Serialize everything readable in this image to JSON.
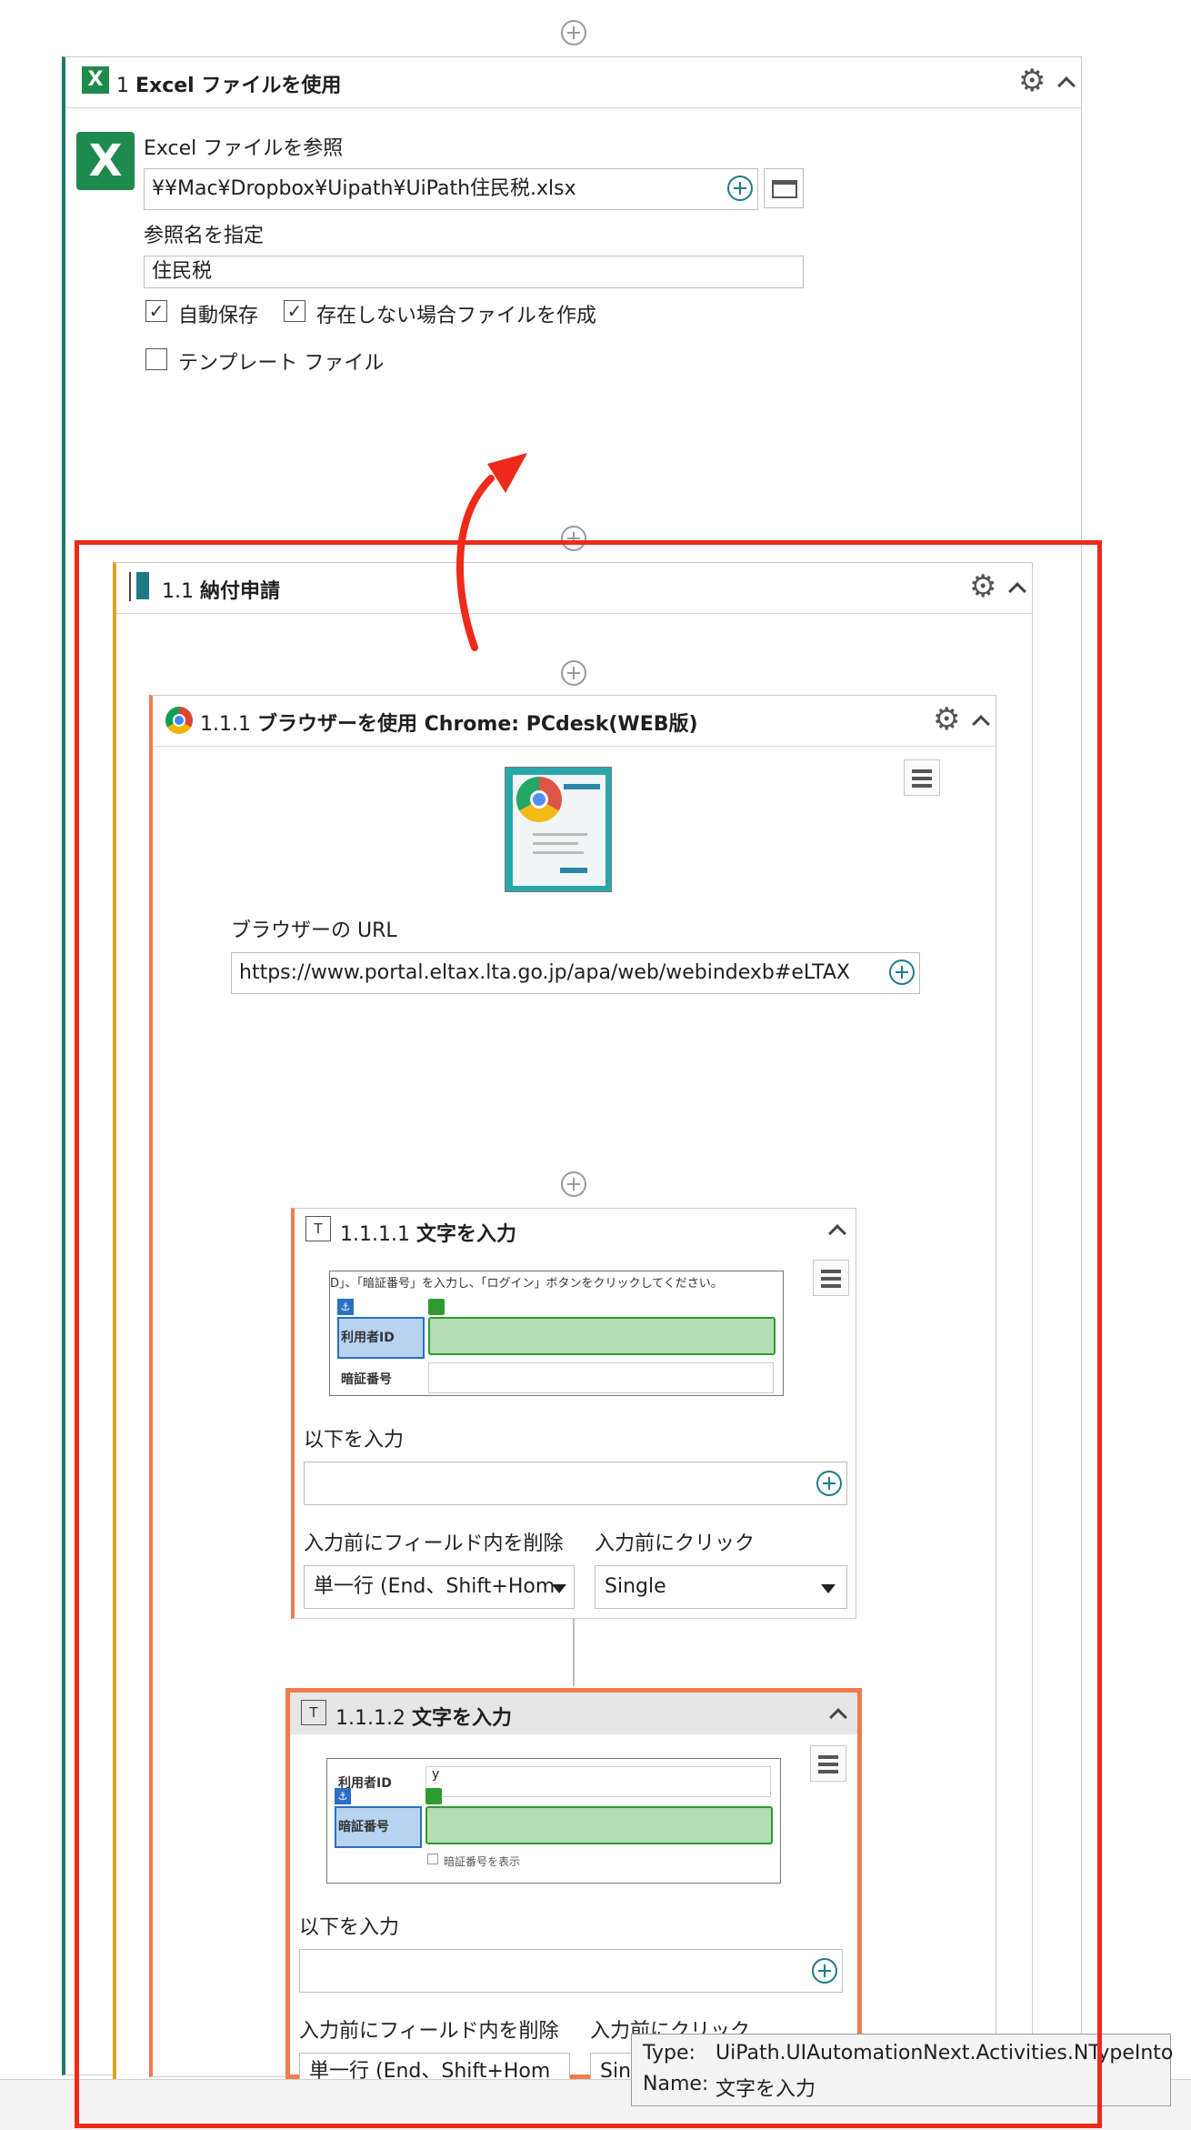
{
  "top_scope": {
    "title_num": "1",
    "title": "Excel ファイルを使用",
    "file_label": "Excel ファイルを参照",
    "file_path": "¥¥Mac¥Dropbox¥Uipath¥UiPath住民税.xlsx",
    "ref_label": "参照名を指定",
    "ref_name": "住民税",
    "autosave_label": "自動保存",
    "create_label": "存在しない場合ファイルを作成",
    "template_label": "テンプレート ファイル",
    "autosave_checked": true,
    "create_checked": true,
    "template_checked": false
  },
  "sequence": {
    "num": "1.1",
    "title": "納付申請"
  },
  "browser": {
    "num": "1.1.1",
    "title": "ブラウザーを使用 Chrome: PCdesk(WEB版)",
    "url_label": "ブラウザーの URL",
    "url": "https://www.portal.eltax.lta.go.jp/apa/web/webindexb#eLTAX"
  },
  "type1": {
    "num": "1.1.1.1",
    "title": "文字を入力",
    "preview_text": "D」、「暗証番号」を入力し、「ログイン」ボタンをクリックしてください。",
    "field1": "利用者ID",
    "field2": "暗証番号",
    "input_label": "以下を入力",
    "clear_label": "入力前にフィールド内を削除",
    "click_label": "入力前にクリック",
    "clear_value": "単一行 (End、Shift+Hom",
    "click_value": "Single"
  },
  "type2": {
    "num": "1.1.1.2",
    "title": "文字を入力",
    "field1": "利用者ID",
    "field1_value": "y",
    "field2": "暗証番号",
    "show_pw": "暗証番号を表示",
    "input_label": "以下を入力",
    "clear_label": "入力前にフィールド内を削除",
    "click_label": "入力前にクリック",
    "clear_value": "単一行 (End、Shift+Hom",
    "click_value": "Sin"
  },
  "tooltip": {
    "type_key": "Type:",
    "type_val": "UiPath.UIAutomationNext.Activities.NTypeInto",
    "name_key": "Name:",
    "name_val": "文字を入力"
  },
  "colors": {
    "excel_green": "#1e8a4c",
    "annotation_red": "#ee2a1a",
    "sequence_bar": "#e3a21a",
    "browser_bar": "#ef7b4f",
    "teal": "#1e7a86"
  }
}
